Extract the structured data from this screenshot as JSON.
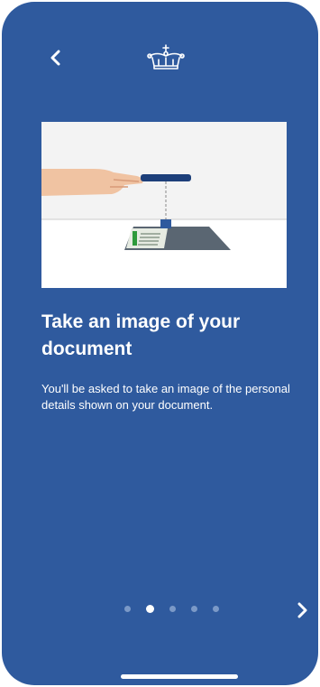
{
  "header": {
    "back_icon": "chevron-left-icon",
    "logo_icon": "crown-icon"
  },
  "illustration": {
    "description_icon": "phone-scanning-document-icon"
  },
  "content": {
    "title": "Take an image of your document",
    "body": "You'll be asked to take an image of the personal details shown on your document."
  },
  "pager": {
    "total_pages": 5,
    "current_page": 2
  },
  "footer": {
    "next_icon": "chevron-right-icon"
  },
  "colors": {
    "background": "#2f5a9e",
    "text": "#ffffff",
    "dot_inactive": "#7b99c7",
    "dot_active": "#ffffff"
  }
}
